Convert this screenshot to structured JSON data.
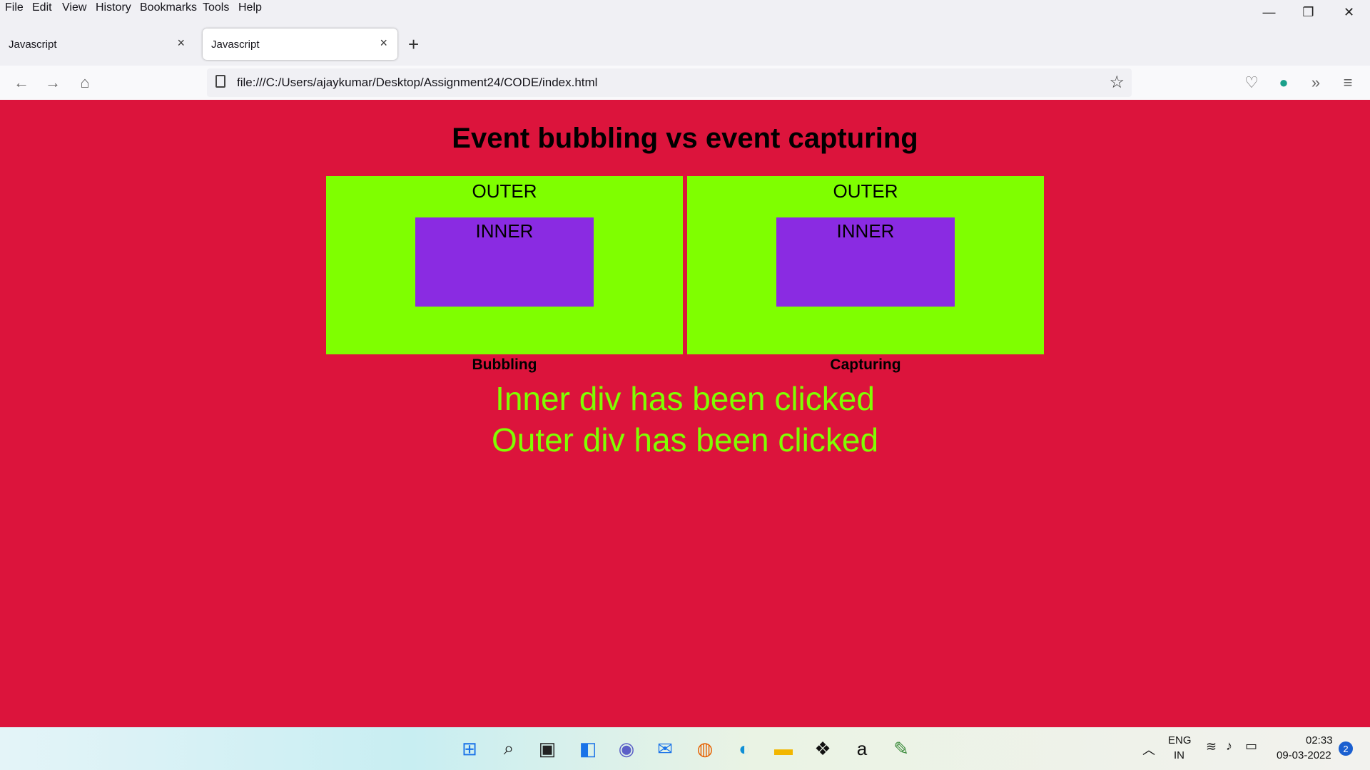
{
  "menu": [
    "File",
    "Edit",
    "View",
    "History",
    "Bookmarks",
    "Tools",
    "Help"
  ],
  "tabs": [
    {
      "title": "Javascript",
      "active": false
    },
    {
      "title": "Javascript",
      "active": true
    }
  ],
  "nav": {
    "url": "file:///C:/Users/ajaykumar/Desktop/Assignment24/CODE/index.html"
  },
  "page": {
    "heading": "Event bubbling vs event capturing",
    "boxes": [
      {
        "outer_label": "OUTER",
        "inner_label": "INNER",
        "caption": "Bubbling"
      },
      {
        "outer_label": "OUTER",
        "inner_label": "INNER",
        "caption": "Capturing"
      }
    ],
    "messages": [
      "Inner div has been clicked",
      "Outer div has been clicked"
    ],
    "colors": {
      "background": "#dc143c",
      "outer": "#7fff00",
      "inner": "#8a2be2",
      "message": "#7fff00"
    }
  },
  "taskbar": {
    "icons": [
      "windows-start-icon",
      "search-icon",
      "task-view-icon",
      "widgets-icon",
      "chat-icon",
      "mail-icon",
      "firefox-icon",
      "edge-icon",
      "file-explorer-icon",
      "dropbox-icon",
      "amazon-icon",
      "notepad-icon"
    ],
    "lang_top": "ENG",
    "lang_bottom": "IN",
    "time": "02:33",
    "date": "09-03-2022",
    "notifications": "2"
  }
}
